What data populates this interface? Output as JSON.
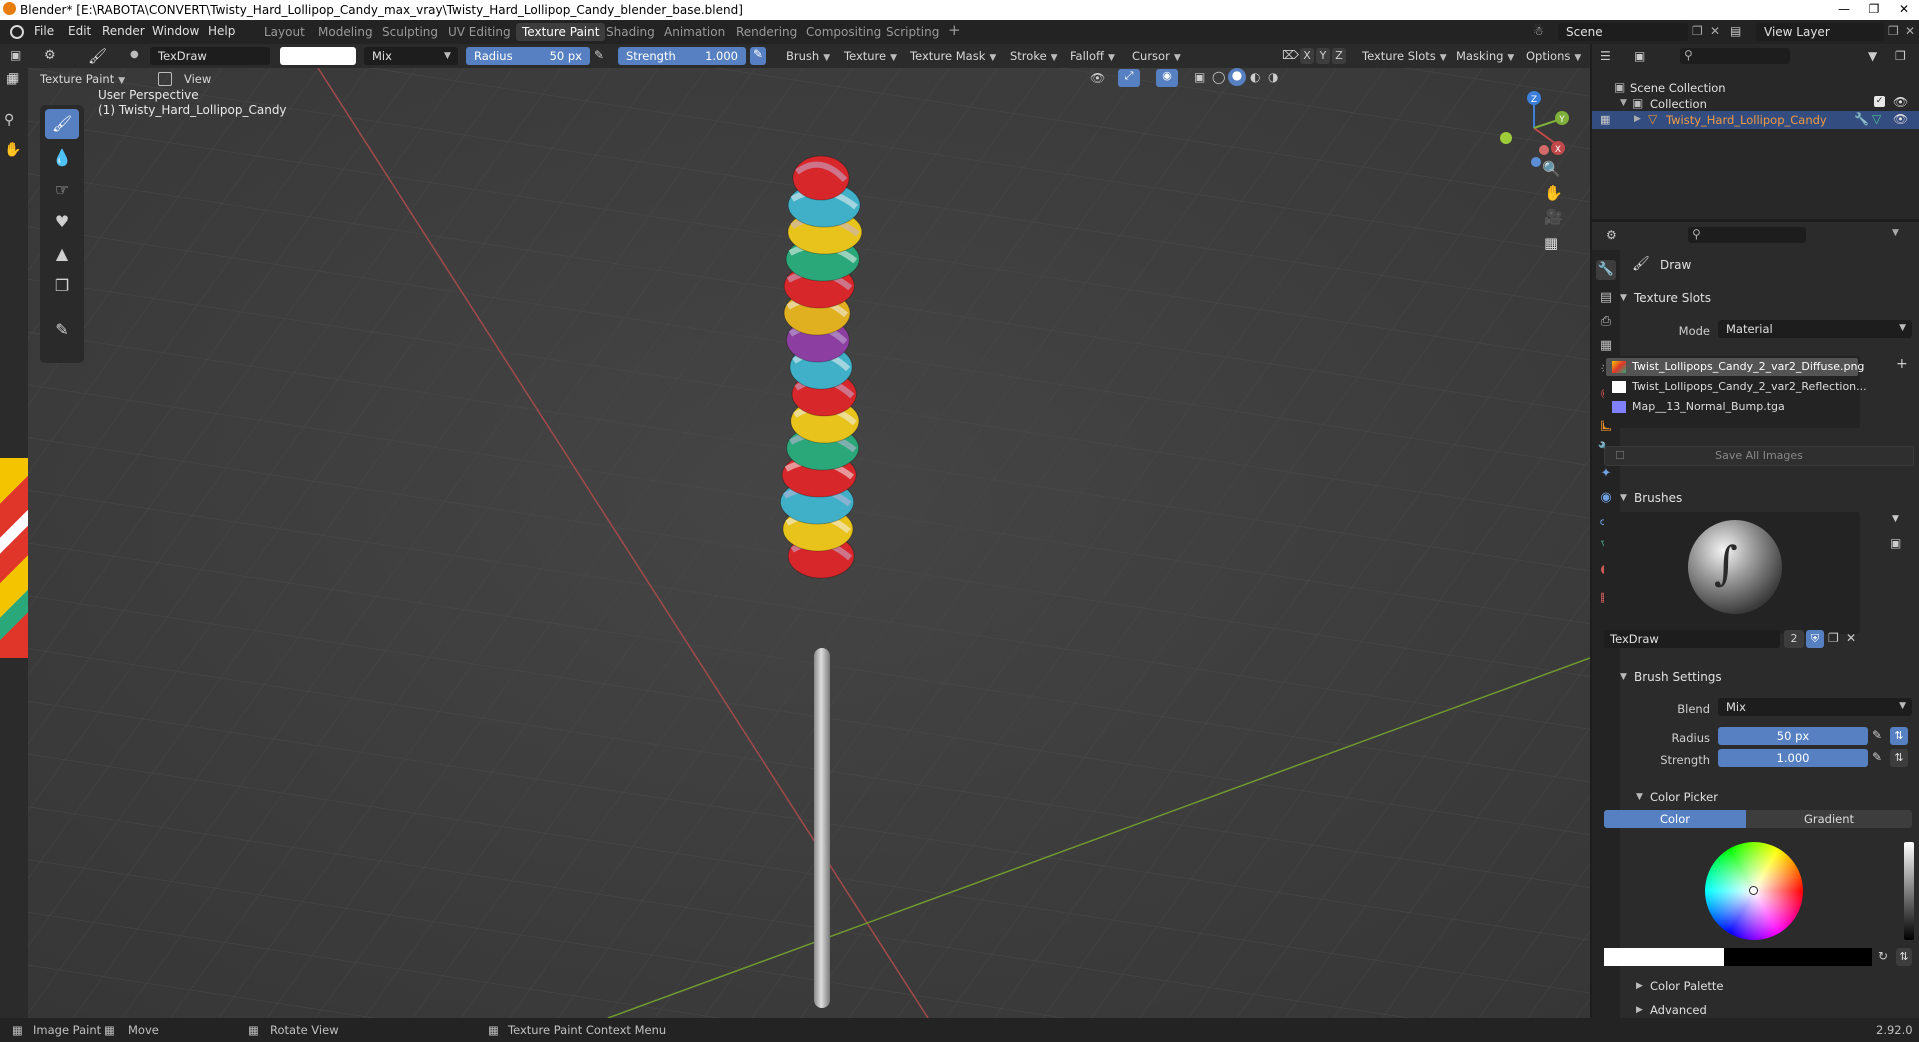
{
  "window": {
    "title": "Blender* [E:\\RABOTA\\CONVERT\\Twisty_Hard_Lollipop_Candy_max_vray\\Twisty_Hard_Lollipop_Candy_blender_base.blend]"
  },
  "menu": {
    "items": [
      "File",
      "Edit",
      "Render",
      "Window",
      "Help"
    ]
  },
  "workspaces": {
    "tabs": [
      "Layout",
      "Modeling",
      "Sculpting",
      "UV Editing",
      "Texture Paint",
      "Shading",
      "Animation",
      "Rendering",
      "Compositing",
      "Scripting"
    ],
    "active": "Texture Paint",
    "add": "+"
  },
  "scene": {
    "label": "Scene",
    "view_layer": "View Layer"
  },
  "tool_header": {
    "brush_name": "TexDraw",
    "blend": "Mix",
    "radius_label": "Radius",
    "radius_value": "50 px",
    "strength_label": "Strength",
    "strength_value": "1.000",
    "menus": [
      "Brush",
      "Texture",
      "Texture Mask",
      "Stroke",
      "Falloff",
      "Cursor"
    ],
    "axes": [
      "X",
      "Y",
      "Z"
    ],
    "right_menus": [
      "Texture Slots",
      "Masking",
      "Options"
    ]
  },
  "mode_header": {
    "mode": "Texture Paint",
    "view": "View"
  },
  "viewport": {
    "perspective": "User Perspective",
    "object": "(1) Twisty_Hard_Lollipop_Candy",
    "gizmo_axes": [
      "X",
      "Y",
      "Z"
    ]
  },
  "outliner": {
    "scene_collection": "Scene Collection",
    "collection": "Collection",
    "object": "Twisty_Hard_Lollipop_Candy"
  },
  "properties": {
    "active_tool": "Draw",
    "texture_slots": {
      "header": "Texture Slots",
      "mode_label": "Mode",
      "mode_value": "Material",
      "slots": [
        "Twist_Lollipops_Candy_2_var2_Diffuse.png",
        "Twist_Lollipops_Candy_2_var2_Reflection...",
        "Map__13_Normal_Bump.tga"
      ],
      "save_all": "Save All Images"
    },
    "brushes": {
      "header": "Brushes",
      "name": "TexDraw",
      "users": "2"
    },
    "brush_settings": {
      "header": "Brush Settings",
      "blend_label": "Blend",
      "blend_value": "Mix",
      "radius_label": "Radius",
      "radius_value": "50 px",
      "strength_label": "Strength",
      "strength_value": "1.000"
    },
    "color_picker": {
      "header": "Color Picker",
      "tab_color": "Color",
      "tab_gradient": "Gradient"
    },
    "color_palette": "Color Palette",
    "advanced": "Advanced"
  },
  "status": {
    "image_paint": "Image Paint",
    "move": "Move",
    "rotate": "Rotate View",
    "context": "Texture Paint Context Menu",
    "version": "2.92.0"
  },
  "colors": {
    "accent": "#5680c2",
    "active_tab": "#3d3d3d",
    "axis_x": "#c04848",
    "axis_y": "#7fb03a",
    "axis_z": "#3c7fd8"
  }
}
